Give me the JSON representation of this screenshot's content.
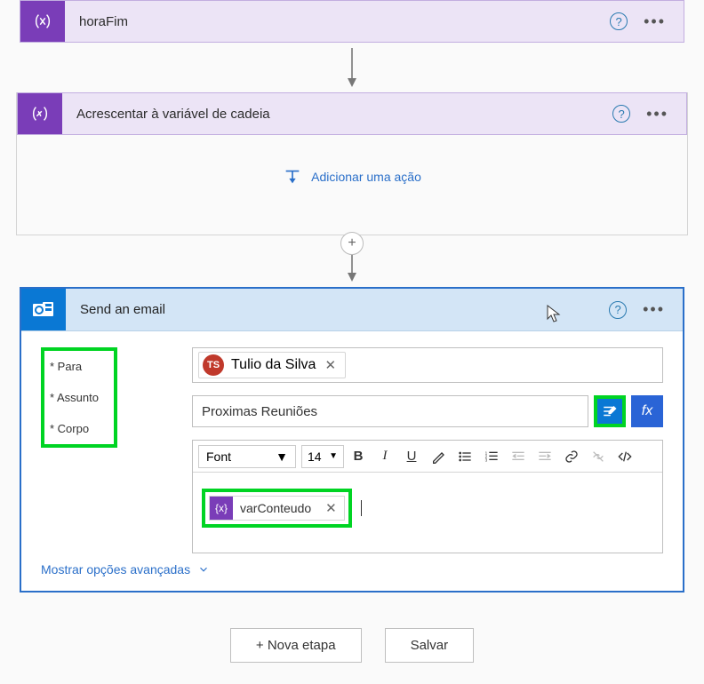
{
  "actions": {
    "horaFim": {
      "title": "horaFim"
    },
    "appendVar": {
      "title": "Acrescentar à variável de cadeia"
    }
  },
  "addAction": "Adicionar uma ação",
  "emailCard": {
    "title": "Send an email",
    "labels": {
      "para": "* Para",
      "assunto": "* Assunto",
      "corpo": "* Corpo"
    },
    "to": {
      "name": "Tulio da Silva",
      "initials": "TS"
    },
    "subject": "Proximas Reuniões",
    "fxLabel": "fx",
    "toolbar": {
      "font": "Font",
      "size": "14"
    },
    "bodyVar": "varConteudo",
    "advanced": "Mostrar opções avançadas"
  },
  "footer": {
    "newStep": "+ Nova etapa",
    "save": "Salvar"
  }
}
